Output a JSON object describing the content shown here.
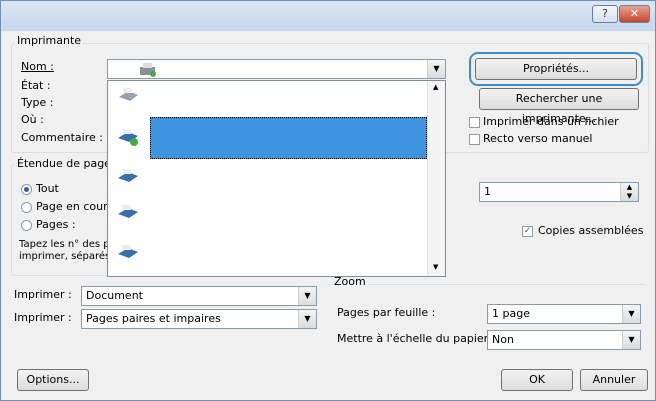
{
  "titlebar": {
    "help_label": "?",
    "close_label": "✕"
  },
  "printer": {
    "group_label": "Imprimante",
    "name_label": "Nom :",
    "status_label": "État :",
    "type_label": "Type :",
    "where_label": "Où :",
    "comment_label": "Commentaire :",
    "properties_button": "Propriétés...",
    "find_printer_button": "Rechercher une imprimante...",
    "print_to_file": "Imprimer dans un fichier",
    "manual_duplex": "Recto verso manuel",
    "print_to_file_checked": false,
    "manual_duplex_checked": false
  },
  "page_range": {
    "group_label": "Étendue de page",
    "all": "Tout",
    "current": "Page en cours",
    "pages": "Pages :",
    "hint_line1": "Tapez les n° des p",
    "hint_line2": "imprimer, séparés",
    "selected": "all"
  },
  "copies": {
    "count": "1",
    "collate": "Copies assemblées",
    "collate_checked": true
  },
  "print_what": {
    "label": "Imprimer :",
    "value": "Document"
  },
  "print_pages": {
    "label": "Imprimer :",
    "value": "Pages paires et impaires"
  },
  "zoom": {
    "group_label": "Zoom",
    "pages_per_sheet_label": "Pages par feuille :",
    "pages_per_sheet_value": "1 page",
    "scale_label": "Mettre à l'échelle du papier :",
    "scale_value": "Non"
  },
  "footer": {
    "options_button": "Options...",
    "ok_button": "OK",
    "cancel_button": "Annuler"
  },
  "dropdown": {
    "item_count": 6,
    "selected_index": 2
  },
  "colors": {
    "accent": "#3d95e0",
    "focus_outline": "#3b8fd0"
  }
}
